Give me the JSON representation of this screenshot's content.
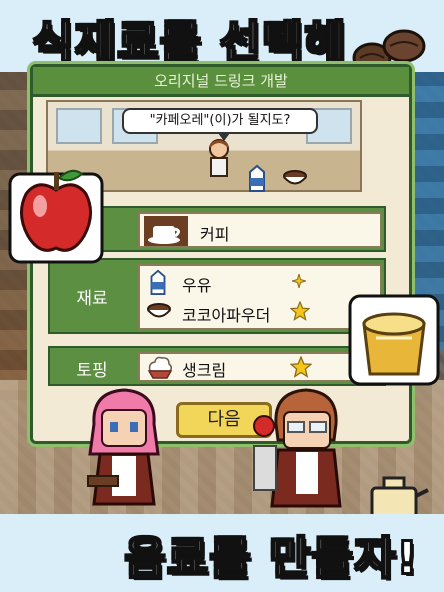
{
  "banner": {
    "top_title": "식재료를 선택해",
    "bottom_title": "음료를 만들자!"
  },
  "dialog": {
    "header_text": "오리지널 드링크 개발",
    "speech_text": "\"카페오레\"(이)가 될지도?"
  },
  "coffee_row": {
    "item_label": "커피",
    "icon": "coffee-cup-icon"
  },
  "material_row": {
    "label": "재료",
    "items": [
      {
        "label": "우유",
        "icon": "milk-carton-icon",
        "rating_icon": "sparkle-icon"
      },
      {
        "label": "코코아파우더",
        "icon": "cocoa-bowl-icon",
        "rating_icon": "star-icon"
      }
    ]
  },
  "topping_row": {
    "label": "토핑",
    "item_label": "생크림",
    "icon": "whipped-cream-icon",
    "rating_icon": "star-icon"
  },
  "next_button": {
    "label": "다음"
  },
  "colors": {
    "panel_green": "#5c8f42",
    "panel_border": "#2f5a2b",
    "button_yellow": "#f2d65a",
    "star_yellow": "#f5c518"
  }
}
